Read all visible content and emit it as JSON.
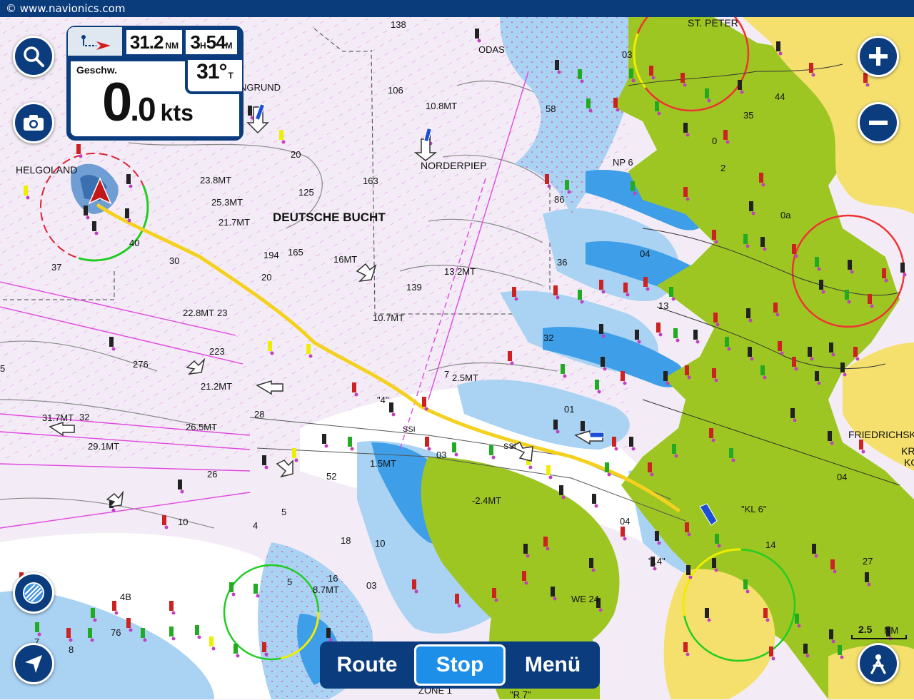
{
  "copyright": "© www.navionics.com",
  "panel": {
    "distance": {
      "value": "31.2",
      "unit": "NM"
    },
    "time": {
      "hours": "3",
      "h_unit": "H",
      "minutes": "54",
      "m_unit": "M"
    },
    "heading": {
      "value": "31°",
      "unit": "T"
    },
    "speed_label": "Geschw.",
    "speed": {
      "int": "0",
      "dec": ".0",
      "unit": "kts"
    }
  },
  "bottom_bar": {
    "route": "Route",
    "stop": "Stop",
    "menu": "Menü"
  },
  "scale": {
    "value": "2.5",
    "unit": "NM"
  },
  "places": {
    "helgoland": "HELGOLAND",
    "deutsche_bucht": "DEUTSCHE BUCHT",
    "norderpiep": "NORDERPIEP",
    "st_peter": "ST. PETER",
    "friedrichsk": "FRIEDRICHSK",
    "kr": "KR",
    "ko": "KO",
    "odas": "ODAS",
    "ngrund": "NGRUND",
    "np6": "NP 6",
    "we24": "WE 24",
    "kl6": "\"KL 6\"",
    "zone1": "ZONE 1",
    "r7": "\"R 7\"",
    "q4": "\"4\"",
    "n14": "\"14\"",
    "ssi1": "SSI",
    "ssi2": "SSI"
  },
  "mt_labels": {
    "l1": "23.8MT",
    "l2": "25.3MT",
    "l3": "21.7MT",
    "l4": "16MT",
    "l5": "13.2MT",
    "l6": "10.8MT",
    "l7": "22.8MT",
    "l8": "10.7MT",
    "l9": "2.5MT",
    "l10": "21.2MT",
    "l11": "31.7MT",
    "l12": "26.5MT",
    "l13": "29.1MT",
    "l14": "1.5MT",
    "l15": "-2.4MT",
    "l16": "8.7MT"
  },
  "depths": {
    "d1": "138",
    "d2": "106",
    "d3": "20",
    "d4": "125",
    "d5": "163",
    "d6": "194",
    "d7": "165",
    "d8": "139",
    "d9": "20",
    "d10": "30",
    "d11": "40",
    "d12": "37",
    "d13": "23",
    "d14": "223",
    "d15": "276",
    "d16": "32",
    "d17": "28",
    "d18": "26",
    "d19": "52",
    "d20": "10",
    "d21": "5",
    "d22": "18",
    "d23": "16",
    "d24": "10",
    "d25": "03",
    "d26": "5",
    "d27": "4",
    "d28": "58",
    "d29": "86",
    "d30": "36",
    "d31": "32",
    "d32": "01",
    "d33": "03",
    "d34": "04",
    "d35": "13",
    "d36": "14",
    "d37": "04",
    "d38": "44",
    "d39": "35",
    "d40": "0a",
    "d41": "03",
    "d42": "2",
    "d43": "0",
    "d44": "04",
    "d45": "27",
    "d46": "7",
    "d47": "5",
    "d48": "4B",
    "d49": "76",
    "d50": "8",
    "d51": "7"
  }
}
